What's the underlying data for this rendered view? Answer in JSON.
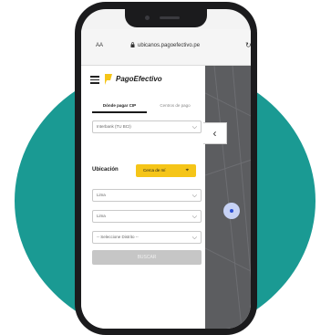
{
  "browser": {
    "text_size_button": "AA",
    "url": "ubicanos.pagoefectivo.pe",
    "reload_icon": "reload-icon"
  },
  "app": {
    "brand_name": "PagoEfectivo",
    "tabs": [
      {
        "label": "Dónde pagar CIP"
      },
      {
        "label": "Centros de pago"
      }
    ],
    "collapse_icon": "chevron-left-icon",
    "selects": {
      "bank": "Interbank (TU BCI)",
      "department": "Lima",
      "province": "Lima",
      "district": "-- Seleccione Distrito --"
    },
    "location_label": "Ubicación",
    "location_button": "Cerca de mí",
    "search_button": "BUSCAR"
  },
  "colors": {
    "teal": "#1a9a93",
    "accent_yellow": "#f5c518",
    "map_gray": "#5c5d60"
  }
}
